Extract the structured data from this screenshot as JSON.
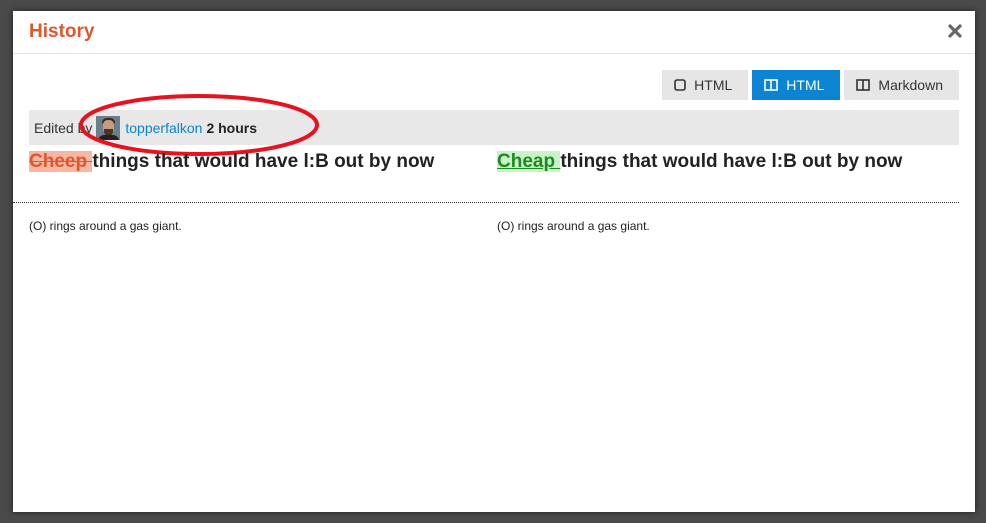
{
  "modal": {
    "title": "History"
  },
  "toolbar": {
    "buttons": [
      {
        "label": "HTML",
        "icon": "square-icon",
        "active": false
      },
      {
        "label": "HTML",
        "icon": "split-columns-icon",
        "active": true
      },
      {
        "label": "Markdown",
        "icon": "split-columns-icon",
        "active": false
      }
    ]
  },
  "edit": {
    "edited_by_label": "Edited by",
    "user": "topperfalkon",
    "time": "2 hours"
  },
  "diff": {
    "left": {
      "removed_word": "Cheep ",
      "heading_rest": "things that would have l:B out by now",
      "body": "(O) rings around a gas giant."
    },
    "right": {
      "added_word": "Cheap ",
      "heading_rest": "things that would have l:B out by now",
      "body": "(O) rings around a gas giant."
    }
  },
  "colors": {
    "title": "#e0572e",
    "active_button": "#0b84d1",
    "link": "#0b84d1",
    "annotation": "#e8121e",
    "deleted_bg": "#f7b7a3",
    "inserted_bg": "#c9f2c9"
  }
}
